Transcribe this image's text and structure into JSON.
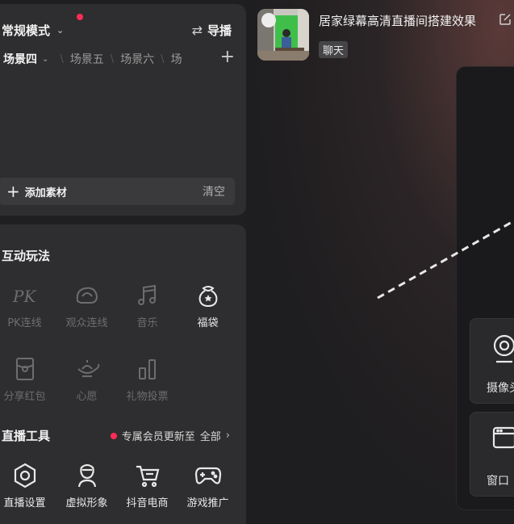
{
  "sidebar": {
    "mode_label": "常规模式",
    "guide_label": "导播",
    "scene_tabs": [
      "场景四",
      "场景五",
      "场景六",
      "场"
    ],
    "add_material_label": "添加素材",
    "clear_label": "清空"
  },
  "interactive": {
    "title": "互动玩法",
    "items": [
      {
        "label": "PK连线",
        "icon": "pk-icon"
      },
      {
        "label": "观众连线",
        "icon": "audience-link-icon"
      },
      {
        "label": "音乐",
        "icon": "music-icon"
      },
      {
        "label": "福袋",
        "icon": "lucky-bag-icon"
      },
      {
        "label": "分享红包",
        "icon": "red-packet-icon"
      },
      {
        "label": "心愿",
        "icon": "wish-lamp-icon"
      },
      {
        "label": "礼物投票",
        "icon": "gift-vote-icon"
      }
    ]
  },
  "tools": {
    "title": "直播工具",
    "vip_text": "专属会员更新至",
    "all_label": "全部",
    "items": [
      {
        "label": "直播设置",
        "icon": "settings-hex-icon"
      },
      {
        "label": "虚拟形象",
        "icon": "avatar-icon"
      },
      {
        "label": "抖音电商",
        "icon": "cart-icon"
      },
      {
        "label": "游戏推广",
        "icon": "gamepad-icon"
      }
    ]
  },
  "room": {
    "title": "居家绿幕高清直播间搭建效果",
    "tag": "聊天"
  },
  "side_sources": [
    {
      "label": "摄像头",
      "icon": "camera-icon"
    },
    {
      "label": "窗口",
      "icon": "window-icon"
    }
  ],
  "colors": {
    "accent_red": "#fe2c55",
    "panel": "#2e2d2f",
    "background": "#1f1e20"
  }
}
